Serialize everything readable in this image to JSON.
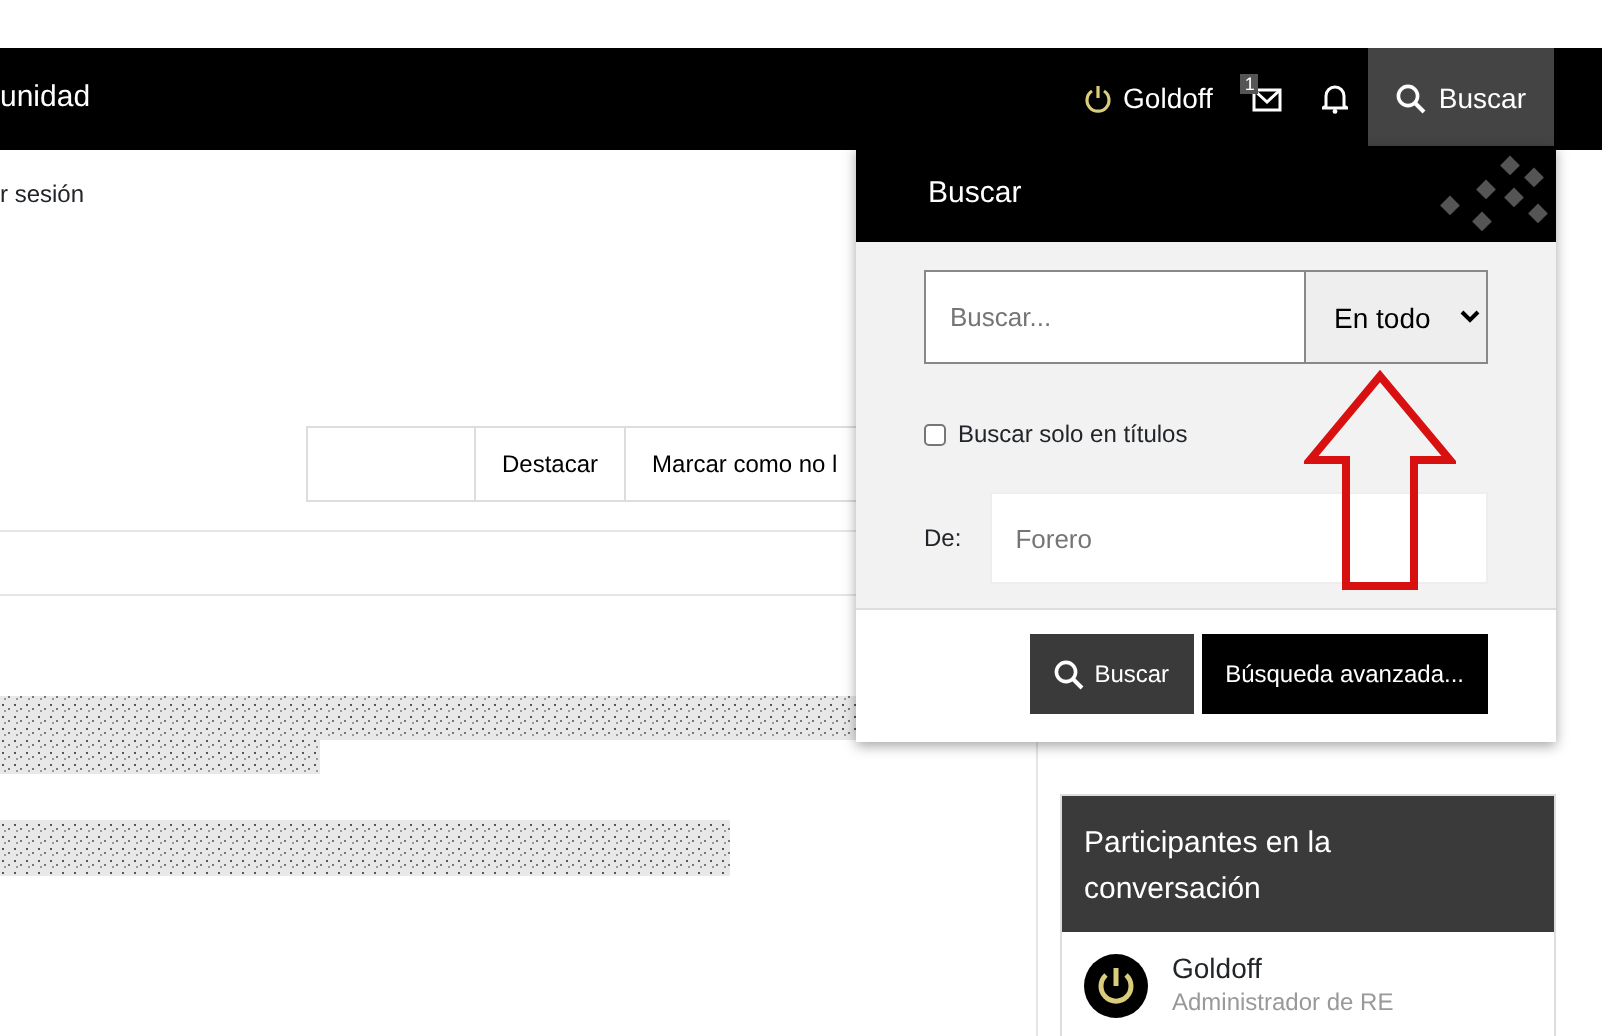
{
  "navbar": {
    "brand_partial": "unidad",
    "user": "Goldoff",
    "inbox_badge": "1",
    "search_label": "Buscar"
  },
  "breadcrumb_partial": "r sesión",
  "thread_actions": [
    "Destacar",
    "Marcar como no l"
  ],
  "search_popup": {
    "title": "Buscar",
    "query": {
      "placeholder": "Buscar..."
    },
    "scope": "En todo",
    "titles_only": {
      "label": "Buscar solo en títulos",
      "checked": false
    },
    "from": {
      "label": "De:",
      "placeholder": "Forero"
    },
    "buttons": [
      {
        "label": "Buscar",
        "kind": "icon"
      },
      {
        "label": "Búsqueda avanzada...",
        "kind": "plain"
      }
    ]
  },
  "participants": {
    "title": "Participantes en la conversación",
    "members": [
      {
        "name": "Goldoff",
        "role": "Administrador de RE"
      }
    ]
  }
}
